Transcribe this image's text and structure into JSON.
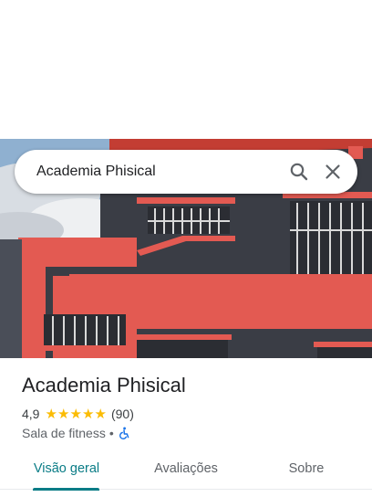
{
  "search": {
    "query": "Academia Phisical"
  },
  "place": {
    "name": "Academia Phisical",
    "rating": "4,9",
    "stars_filled": 5,
    "review_count": "(90)",
    "category": "Sala de fitness",
    "separator": "•",
    "accessibility_icon": "wheelchair-icon"
  },
  "tabs": [
    {
      "label": "Visão geral",
      "active": true
    },
    {
      "label": "Avaliações",
      "active": false
    },
    {
      "label": "Sobre",
      "active": false
    }
  ],
  "colors": {
    "accent": "#0a7c86",
    "star": "#fbbc04",
    "building_red": "#e35a52",
    "building_dark": "#3a3d45"
  }
}
